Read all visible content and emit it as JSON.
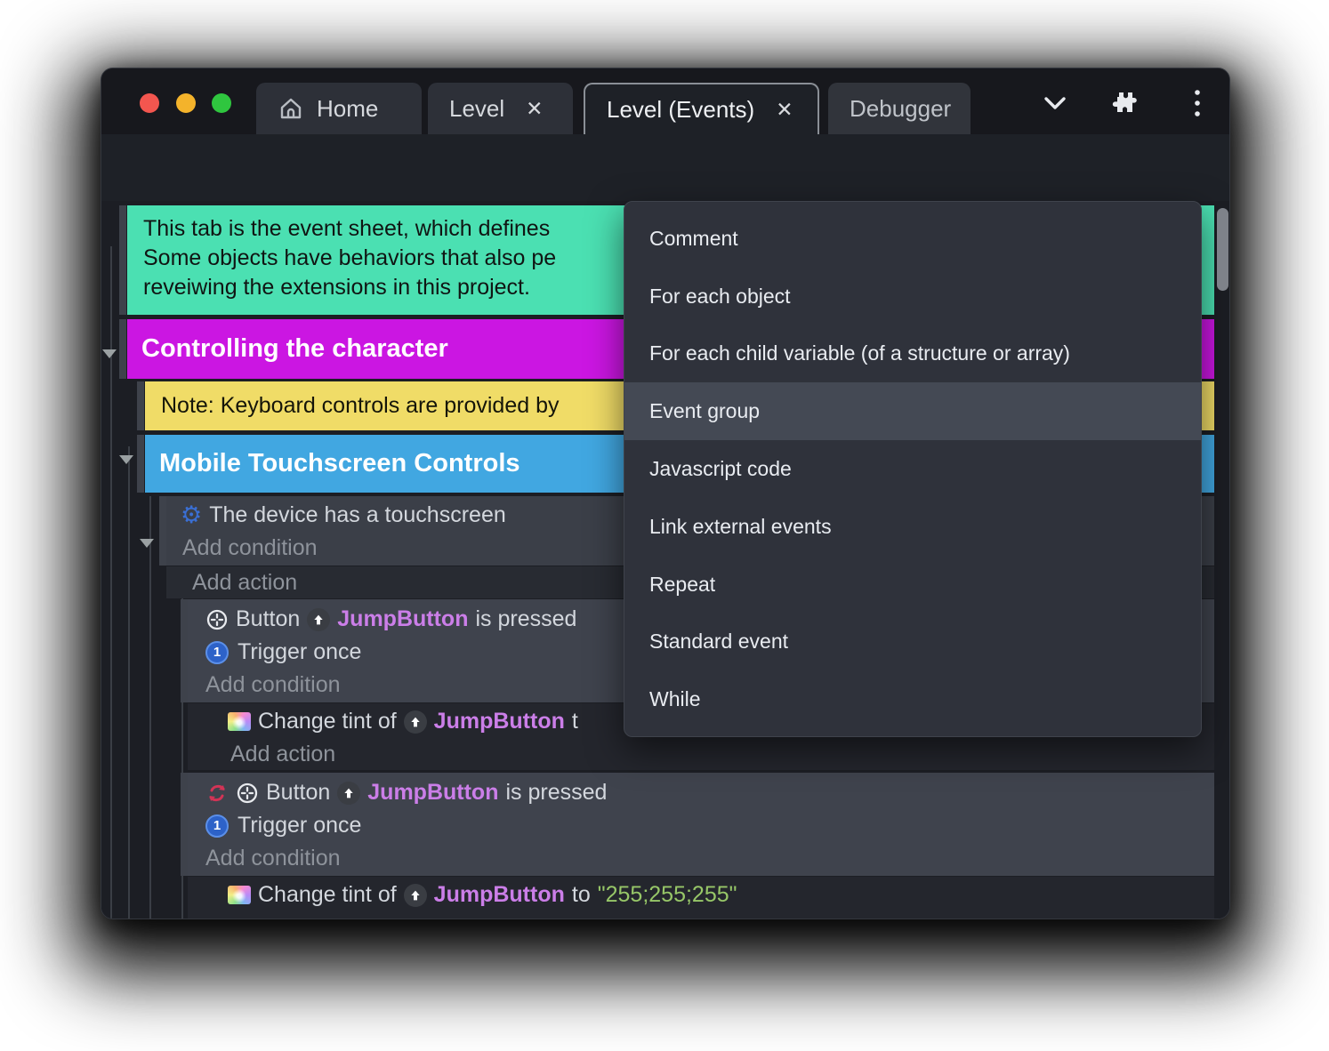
{
  "window": {
    "tabs": [
      {
        "label": "Home"
      },
      {
        "label": "Level"
      },
      {
        "label": "Level (Events)"
      },
      {
        "label": "Debugger"
      }
    ],
    "close_glyph": "✕"
  },
  "menu": {
    "items": [
      {
        "label": "Comment"
      },
      {
        "label": "For each object"
      },
      {
        "label": "For each child variable (of a structure or array)"
      },
      {
        "label": "Event group"
      },
      {
        "label": "Javascript code"
      },
      {
        "label": "Link external events"
      },
      {
        "label": "Repeat"
      },
      {
        "label": "Standard event"
      },
      {
        "label": "While"
      }
    ],
    "highlighted": "Event group"
  },
  "sheet": {
    "comment_lines": [
      "This tab is the event sheet, which defines",
      "Some objects have behaviors that also pe",
      "reveiwing the extensions in this project."
    ],
    "group1": "Controlling the character",
    "note": "Note: Keyboard controls are provided by",
    "group2": "Mobile Touchscreen Controls",
    "cond_touch": "The device has a touchscreen",
    "add_condition": "Add condition",
    "add_action": "Add action",
    "button_label": "Button",
    "object_name": "JumpButton",
    "is_pressed": "is pressed",
    "trigger_once": "Trigger once",
    "trigger_once_glyph": "1",
    "change_tint": "Change tint of",
    "to_partial": "t",
    "to_word": "to",
    "tint_value": "\"255;255;255\""
  },
  "colors": {
    "accent_purple": "#5b38e0",
    "comment_teal": "#4be0b2",
    "group_magenta": "#cb16e2",
    "note_yellow": "#f0dc67",
    "group_blue": "#41a7e1",
    "object_purple": "#cb7ee8",
    "string_green": "#97c768"
  }
}
